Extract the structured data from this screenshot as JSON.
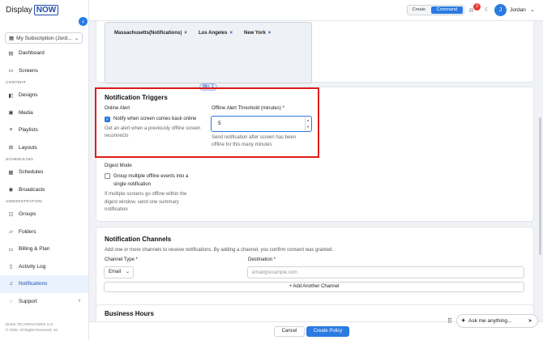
{
  "brand": {
    "part1": "Display",
    "part2": "NOW"
  },
  "subscription": {
    "label": "My Subscription (Jord..."
  },
  "sidebar": {
    "items_top": [
      {
        "label": "Dashboard",
        "icon": "dashboard-icon"
      },
      {
        "label": "Screens",
        "icon": "screens-icon"
      }
    ],
    "sections": [
      {
        "title": "CONTENT",
        "items": [
          {
            "label": "Designs"
          },
          {
            "label": "Media"
          },
          {
            "label": "Playlists"
          },
          {
            "label": "Layouts"
          }
        ]
      },
      {
        "title": "SCHEDULING",
        "items": [
          {
            "label": "Schedules"
          },
          {
            "label": "Broadcasts"
          }
        ]
      },
      {
        "title": "ADMINISTRATION",
        "items": [
          {
            "label": "Groups"
          },
          {
            "label": "Folders"
          },
          {
            "label": "Billing & Plan"
          },
          {
            "label": "Activity Log"
          },
          {
            "label": "Notifications"
          },
          {
            "label": "Support"
          }
        ]
      }
    ],
    "footer_company": "DUKE TECHNOLOGIES LLC",
    "footer_copy": "© 2026. All Rights Reserved. 32"
  },
  "topbar": {
    "mode_create": "Create",
    "mode_command": "Command",
    "notification_count": "3",
    "avatar_initial": "J",
    "username": "Jordan"
  },
  "regions": {
    "tags": [
      "Massachusetts(Notifications)",
      "Los Angeles",
      "New York"
    ]
  },
  "triggers": {
    "title": "Notification Triggers",
    "online_alert_label": "Online Alert",
    "online_checkbox_label": "Notify when screen comes back online",
    "online_help": [
      "Get an alert when a previously offline screen",
      "reconnects"
    ],
    "threshold_label": "Offline Alert Threshold (minutes) *",
    "threshold_badge": "Min: 1",
    "threshold_value": "5",
    "threshold_help": [
      "Send notification after screen has been",
      "offline for this many minutes"
    ],
    "digest_label": "Digest Mode",
    "digest_checkbox_label": [
      "Group multiple offline events into a",
      "single notification"
    ],
    "digest_help": [
      "If multiple screens go offline within the",
      "digest window, send one summary",
      "notification"
    ]
  },
  "channels": {
    "title": "Notification Channels",
    "description": "Add one or more channels to receive notifications. By adding a channel, you confirm consent was granted.",
    "type_label": "Channel Type *",
    "type_value": "Email",
    "destination_label": "Destination *",
    "destination_placeholder": "email@example.com",
    "add_button": "+ Add Another Channel"
  },
  "hours": {
    "title": "Business Hours"
  },
  "footer": {
    "cancel": "Cancel",
    "create": "Create Policy"
  },
  "assistant": {
    "placeholder": "Ask me anything..."
  },
  "colors": {
    "accent": "#2a7ae2",
    "brand": "#1f4fa8",
    "highlight": "#e01b1b"
  }
}
